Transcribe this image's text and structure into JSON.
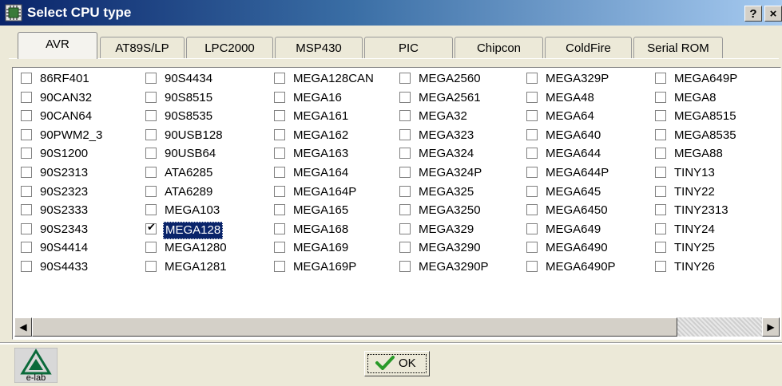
{
  "window": {
    "title": "Select CPU type",
    "help": "?",
    "close": "×"
  },
  "tabs": [
    {
      "label": "AVR",
      "active": true
    },
    {
      "label": "AT89S/LP",
      "active": false
    },
    {
      "label": "LPC2000",
      "active": false
    },
    {
      "label": "MSP430",
      "active": false
    },
    {
      "label": "PIC",
      "active": false
    },
    {
      "label": "Chipcon",
      "active": false
    },
    {
      "label": "ColdFire",
      "active": false
    },
    {
      "label": "Serial ROM",
      "active": false
    }
  ],
  "columns": [
    [
      "86RF401",
      "90CAN32",
      "90CAN64",
      "90PWM2_3",
      "90S1200",
      "90S2313",
      "90S2323",
      "90S2333",
      "90S2343",
      "90S4414",
      "90S4433"
    ],
    [
      "90S4434",
      "90S8515",
      "90S8535",
      "90USB128",
      "90USB64",
      "ATA6285",
      "ATA6289",
      "MEGA103",
      "MEGA128",
      "MEGA1280",
      "MEGA1281"
    ],
    [
      "MEGA128CAN",
      "MEGA16",
      "MEGA161",
      "MEGA162",
      "MEGA163",
      "MEGA164",
      "MEGA164P",
      "MEGA165",
      "MEGA168",
      "MEGA169",
      "MEGA169P"
    ],
    [
      "MEGA2560",
      "MEGA2561",
      "MEGA32",
      "MEGA323",
      "MEGA324",
      "MEGA324P",
      "MEGA325",
      "MEGA3250",
      "MEGA329",
      "MEGA3290",
      "MEGA3290P"
    ],
    [
      "MEGA329P",
      "MEGA48",
      "MEGA64",
      "MEGA640",
      "MEGA644",
      "MEGA644P",
      "MEGA645",
      "MEGA6450",
      "MEGA649",
      "MEGA6490",
      "MEGA6490P"
    ],
    [
      "MEGA649P",
      "MEGA8",
      "MEGA8515",
      "MEGA8535",
      "MEGA88",
      "TINY13",
      "TINY22",
      "TINY2313",
      "TINY24",
      "TINY25",
      "TINY26"
    ]
  ],
  "selected": "MEGA128",
  "ok_label": "OK",
  "logo_text": "e-lab",
  "colors": {
    "titlebar_start": "#0a246a",
    "titlebar_end": "#a6caf0",
    "selection": "#0a246a",
    "ok_check": "#2a9a2a"
  }
}
